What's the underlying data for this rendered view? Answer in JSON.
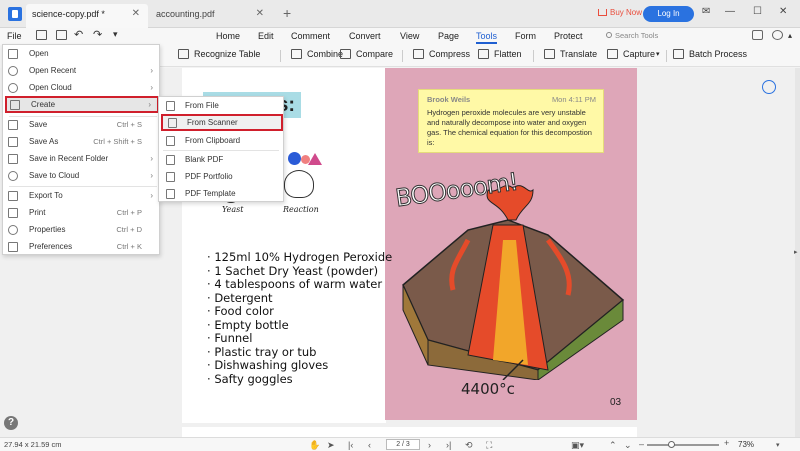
{
  "tabs": [
    {
      "label": "science-copy.pdf *",
      "active": true
    },
    {
      "label": "accounting.pdf",
      "active": false
    }
  ],
  "header": {
    "buy_now": "Buy Now",
    "login": "Log In"
  },
  "menu": {
    "file": "File",
    "main_tabs": [
      "Home",
      "Edit",
      "Comment",
      "Convert",
      "View",
      "Page",
      "Tools",
      "Form",
      "Protect"
    ],
    "active_tab": "Tools",
    "search_placeholder": "Search Tools"
  },
  "toolbar": {
    "items": [
      "Recognize Table",
      "Combine",
      "Compare",
      "Compress",
      "Flatten",
      "Translate",
      "Capture",
      "Batch Process"
    ]
  },
  "file_menu": {
    "items": [
      {
        "label": "Open",
        "shortcut": "",
        "submenu": false,
        "icon": "folder-icon"
      },
      {
        "label": "Open Recent",
        "shortcut": "",
        "submenu": true,
        "icon": "clock-icon"
      },
      {
        "label": "Open Cloud",
        "shortcut": "",
        "submenu": true,
        "icon": "cloud-icon"
      },
      {
        "label": "Create",
        "shortcut": "",
        "submenu": true,
        "icon": "create-icon",
        "selected": true
      },
      {
        "label": "Save",
        "shortcut": "Ctrl + S",
        "submenu": false,
        "icon": "save-icon"
      },
      {
        "label": "Save As",
        "shortcut": "Ctrl + Shift + S",
        "submenu": false,
        "icon": "save-as-icon"
      },
      {
        "label": "Save in Recent Folder",
        "shortcut": "",
        "submenu": true,
        "icon": "folder-save-icon"
      },
      {
        "label": "Save to Cloud",
        "shortcut": "",
        "submenu": true,
        "icon": "cloud-save-icon"
      },
      {
        "label": "Export To",
        "shortcut": "",
        "submenu": true,
        "icon": "export-icon"
      },
      {
        "label": "Print",
        "shortcut": "Ctrl + P",
        "submenu": false,
        "icon": "print-icon"
      },
      {
        "label": "Properties",
        "shortcut": "Ctrl + D",
        "submenu": false,
        "icon": "properties-icon"
      },
      {
        "label": "Preferences",
        "shortcut": "Ctrl + K",
        "submenu": false,
        "icon": "preferences-icon"
      }
    ]
  },
  "create_submenu": {
    "items": [
      {
        "label": "From File",
        "icon": "file-icon"
      },
      {
        "label": "From Scanner",
        "icon": "scanner-icon",
        "selected": true
      },
      {
        "label": "From Clipboard",
        "icon": "clipboard-icon"
      },
      {
        "label": "Blank PDF",
        "icon": "blank-pdf-icon"
      },
      {
        "label": "PDF Portfolio",
        "icon": "portfolio-icon"
      },
      {
        "label": "PDF Template",
        "icon": "template-icon"
      }
    ]
  },
  "document": {
    "heading_fragment": "s:",
    "label_yeast": "Yeast",
    "label_reaction": "Reaction",
    "ingredients": [
      "125ml 10% Hydrogen Peroxide",
      "1 Sachet Dry Yeast (powder)",
      "4 tablespoons of warm water",
      "Detergent",
      "Food color",
      "Empty bottle",
      "Funnel",
      "Plastic tray or tub",
      "Dishwashing gloves",
      "Safty goggles"
    ],
    "note": {
      "author": "Brook Weils",
      "time": "Mon 4:11 PM",
      "text": "Hydrogen peroxide molecules are very unstable and naturally decompose into water and oxygen gas. The chemical equation for this decompostion is:"
    },
    "boo_text": "BOOooom!",
    "temperature": "4400°c",
    "page_number": "03"
  },
  "status": {
    "dimensions": "27.94 x 21.59 cm",
    "page_indicator": "2 / 3",
    "zoom": "73%",
    "zoom_level": 0.33
  }
}
